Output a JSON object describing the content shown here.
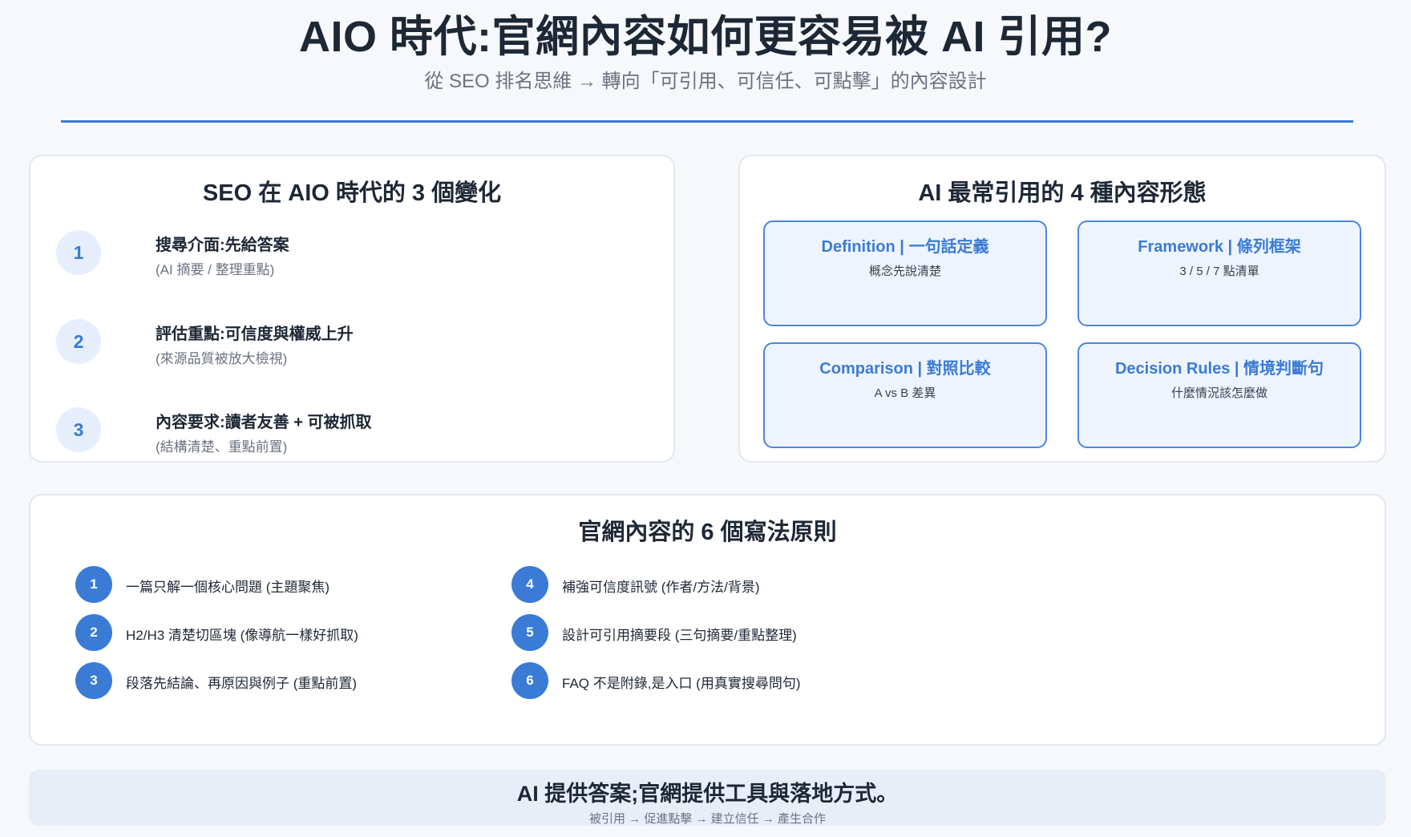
{
  "header": {
    "title": "AIO 時代:官網內容如何更容易被 AI 引用?",
    "subtitle": "從 SEO 排名思維 → 轉向「可引用、可信任、可點擊」的內容設計"
  },
  "changes": {
    "title": "SEO 在 AIO 時代的 3 個變化",
    "items": [
      {
        "num": "1",
        "main": "搜尋介面:先給答案",
        "sub": "(AI 摘要 / 整理重點)"
      },
      {
        "num": "2",
        "main": "評估重點:可信度與權威上升",
        "sub": "(來源品質被放大檢視)"
      },
      {
        "num": "3",
        "main": "內容要求:讀者友善 + 可被抓取",
        "sub": "(結構清楚、重點前置)"
      }
    ]
  },
  "forms": {
    "title": "AI 最常引用的 4 種內容形態",
    "items": [
      {
        "title": "Definition | 一句話定義",
        "desc": "概念先說清楚"
      },
      {
        "title": "Framework | 條列框架",
        "desc": "3 / 5 / 7 點清單"
      },
      {
        "title": "Comparison | 對照比較",
        "desc": "A vs B 差異"
      },
      {
        "title": "Decision Rules | 情境判斷句",
        "desc": "什麼情況該怎麼做"
      }
    ]
  },
  "principles": {
    "title": "官網內容的 6 個寫法原則",
    "items": [
      {
        "num": "1",
        "text": "一篇只解一個核心問題 (主題聚焦)"
      },
      {
        "num": "2",
        "text": "H2/H3 清楚切區塊 (像導航一樣好抓取)"
      },
      {
        "num": "3",
        "text": "段落先結論、再原因與例子 (重點前置)"
      },
      {
        "num": "4",
        "text": "補強可信度訊號 (作者/方法/背景)"
      },
      {
        "num": "5",
        "text": "設計可引用摘要段 (三句摘要/重點整理)"
      },
      {
        "num": "6",
        "text": "FAQ 不是附錄,是入口 (用真實搜尋問句)"
      }
    ]
  },
  "footer": {
    "main": "AI 提供答案;官網提供工具與落地方式。",
    "sub": "被引用 → 促進點擊 → 建立信任 → 產生合作"
  },
  "colors": {
    "accent": "#3a7bd5",
    "accent_light": "#e6eefc",
    "box_fill": "#eef4fd",
    "background": "#f6f8fb"
  }
}
